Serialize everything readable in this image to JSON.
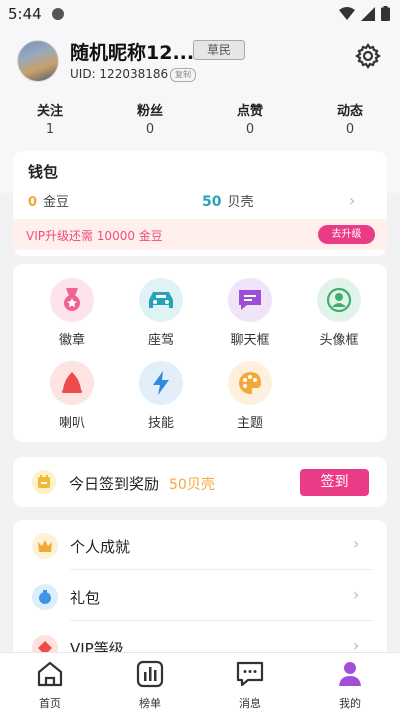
{
  "status": {
    "time": "5:44"
  },
  "profile": {
    "nickname": "随机昵称12...",
    "rank": "草民",
    "uid": "UID: 122038186",
    "copy": "复制"
  },
  "stats": [
    {
      "label": "关注",
      "value": "1"
    },
    {
      "label": "粉丝",
      "value": "0"
    },
    {
      "label": "点赞",
      "value": "0"
    },
    {
      "label": "动态",
      "value": "0"
    }
  ],
  "wallet": {
    "title": "钱包",
    "gold_amount": "0",
    "gold_label": "金豆",
    "shell_amount": "50",
    "shell_label": "贝壳",
    "vip_text": "VIP升级还需 10000 金豆",
    "upgrade_label": "去升级"
  },
  "features": [
    {
      "label": "徽章",
      "icon": "medal-icon",
      "color": "#f06292",
      "bg": "#fde4ec"
    },
    {
      "label": "座驾",
      "icon": "car-icon",
      "color": "#26a3b9",
      "bg": "#dff3f6"
    },
    {
      "label": "聊天框",
      "icon": "chat-frame-icon",
      "color": "#9c4fd6",
      "bg": "#f0e4f9"
    },
    {
      "label": "头像框",
      "icon": "avatar-frame-icon",
      "color": "#3fae6c",
      "bg": "#e2f4e9"
    },
    {
      "label": "喇叭",
      "icon": "horn-icon",
      "color": "#ee4b4b",
      "bg": "#fde3e1"
    },
    {
      "label": "技能",
      "icon": "lightning-icon",
      "color": "#2f8be0",
      "bg": "#e2effb"
    },
    {
      "label": "主题",
      "icon": "palette-icon",
      "color": "#f3a83a",
      "bg": "#fdf0dc"
    }
  ],
  "checkin": {
    "text": "今日签到奖励",
    "reward": "50贝壳",
    "button": "签到"
  },
  "menu": [
    {
      "label": "个人成就",
      "icon": "crown-icon"
    },
    {
      "label": "礼包",
      "icon": "gift-bag-icon"
    },
    {
      "label": "VIP等级",
      "icon": "vip-icon"
    }
  ],
  "tabs": [
    {
      "label": "首页",
      "icon": "home-icon"
    },
    {
      "label": "榜单",
      "icon": "chart-icon"
    },
    {
      "label": "消息",
      "icon": "message-icon"
    },
    {
      "label": "我的",
      "icon": "profile-icon",
      "active": true
    }
  ],
  "colors": {
    "accent": "#ea3c86",
    "gold": "#f3a83a",
    "shell": "#2aa3b8",
    "active_tab": "#a24fd8"
  }
}
